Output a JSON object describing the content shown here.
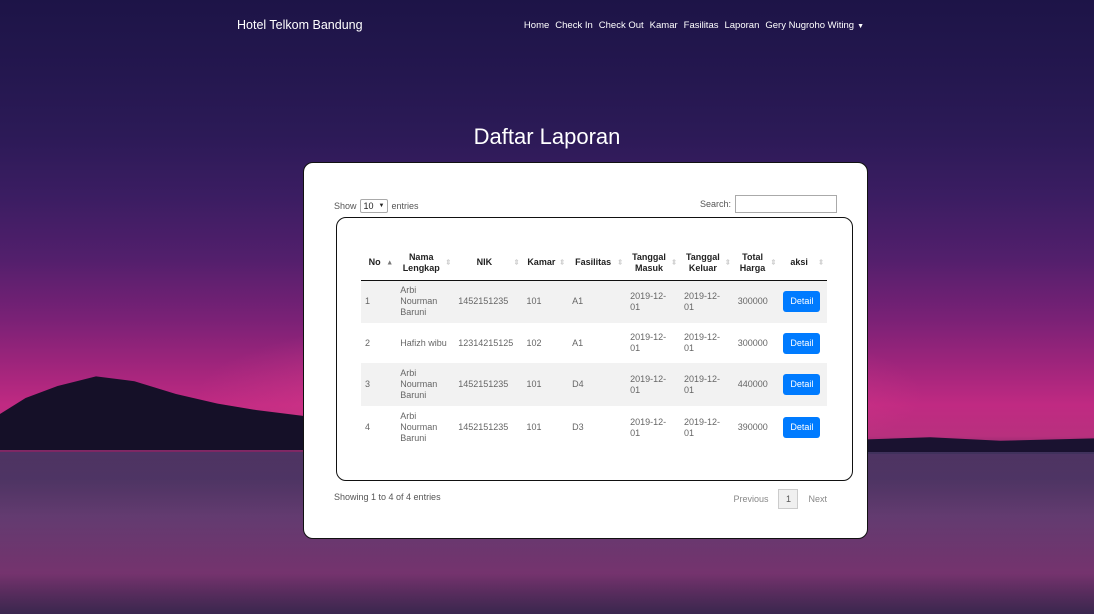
{
  "navbar": {
    "brand": "Hotel Telkom Bandung",
    "links": [
      "Home",
      "Check In",
      "Check Out",
      "Kamar",
      "Fasilitas",
      "Laporan"
    ],
    "user": "Gery Nugroho Witing"
  },
  "page": {
    "title": "Daftar Laporan"
  },
  "datatable": {
    "show_label": "Show",
    "entries_value": "10",
    "entries_label": "entries",
    "search_label": "Search:",
    "search_value": "",
    "columns": [
      "No",
      "Nama Lengkap",
      "NIK",
      "Kamar",
      "Fasilitas",
      "Tanggal Masuk",
      "Tanggal Keluar",
      "Total Harga",
      "aksi"
    ],
    "rows": [
      {
        "no": "1",
        "nama": "Arbi Nourman Baruni",
        "nik": "1452151235",
        "kamar": "101",
        "fasilitas": "A1",
        "masuk": "2019-12-01",
        "keluar": "2019-12-01",
        "harga": "300000",
        "aksi": "Detail"
      },
      {
        "no": "2",
        "nama": "Hafizh wibu",
        "nik": "12314215125",
        "kamar": "102",
        "fasilitas": "A1",
        "masuk": "2019-12-01",
        "keluar": "2019-12-01",
        "harga": "300000",
        "aksi": "Detail"
      },
      {
        "no": "3",
        "nama": "Arbi Nourman Baruni",
        "nik": "1452151235",
        "kamar": "101",
        "fasilitas": "D4",
        "masuk": "2019-12-01",
        "keluar": "2019-12-01",
        "harga": "440000",
        "aksi": "Detail"
      },
      {
        "no": "4",
        "nama": "Arbi Nourman Baruni",
        "nik": "1452151235",
        "kamar": "101",
        "fasilitas": "D3",
        "masuk": "2019-12-01",
        "keluar": "2019-12-01",
        "harga": "390000",
        "aksi": "Detail"
      }
    ],
    "info": "Showing 1 to 4 of 4 entries",
    "previous": "Previous",
    "current_page": "1",
    "next": "Next"
  },
  "colors": {
    "primary_button": "#007bff",
    "card": "#ffffff"
  }
}
